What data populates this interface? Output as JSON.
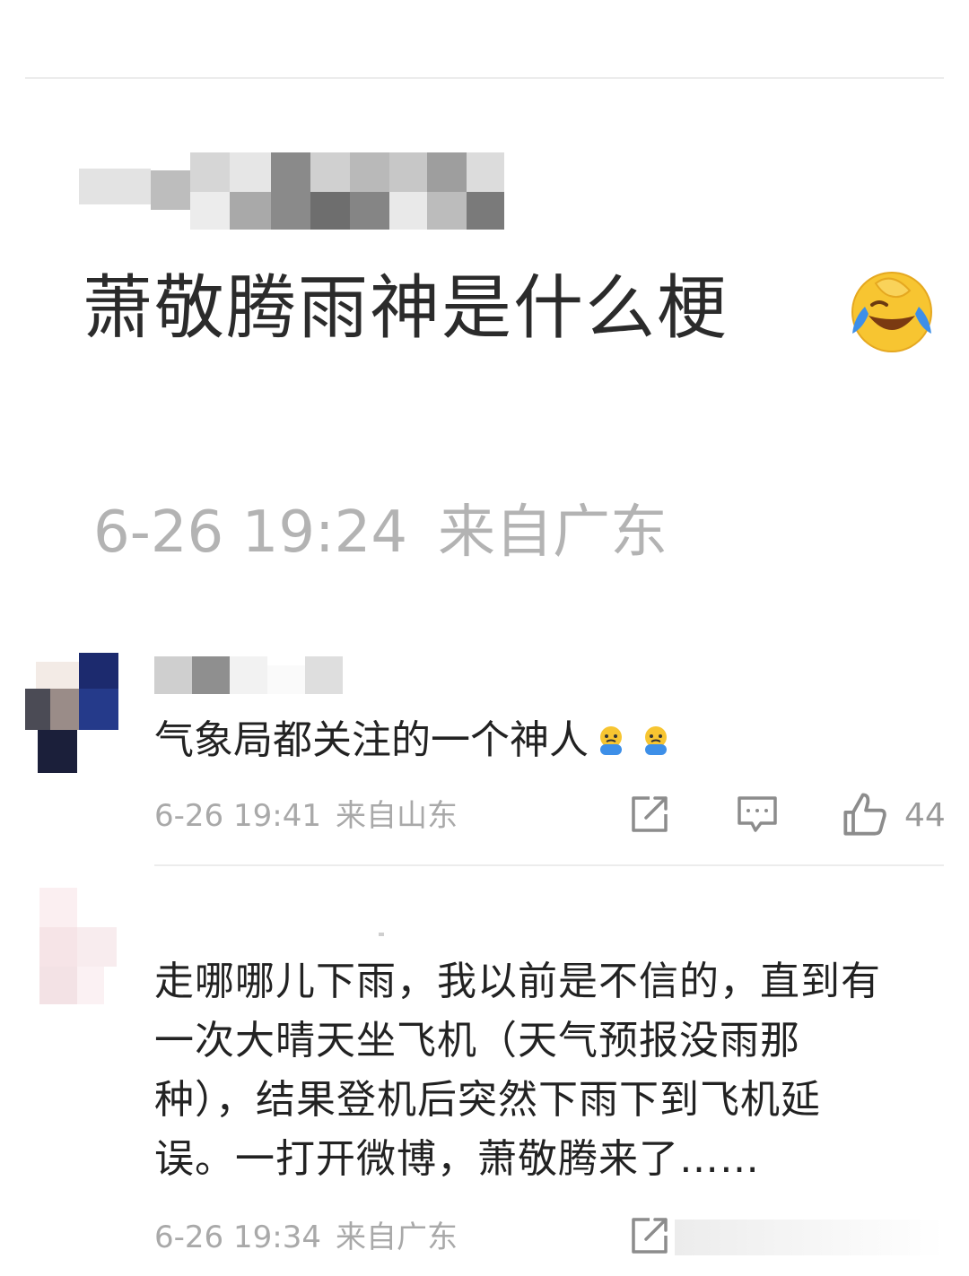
{
  "post": {
    "title": "萧敬腾雨神是什么梗",
    "title_emoji": "laughing-crying-face-icon",
    "date": "6-26 19:24",
    "location": "来自广东"
  },
  "comments": [
    {
      "text": "气象局都关注的一个神人",
      "emojis": [
        "crying-bear-icon",
        "crying-bear-icon"
      ],
      "date": "6-26 19:41",
      "location": "来自山东",
      "likes": "44"
    },
    {
      "text": "走哪哪儿下雨，我以前是不信的，直到有一次大晴天坐飞机（天气预报没雨那种），结果登机后突然下雨下到飞机延误。一打开微博，萧敬腾来了……",
      "date": "6-26 19:34",
      "location": "来自广东"
    }
  ],
  "icons": {
    "share": "share-icon",
    "comment": "comment-icon",
    "like": "thumbs-up-icon"
  },
  "colors": {
    "meta": "#a9a9a9",
    "text": "#222222",
    "divider": "#ececec",
    "emoji_yellow": "#f7c531",
    "emoji_blue": "#3d8fe8"
  }
}
